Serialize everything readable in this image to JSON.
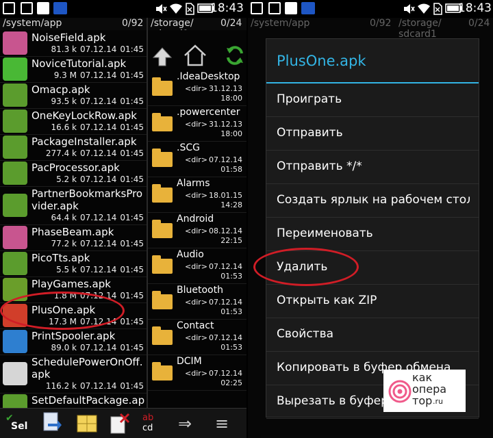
{
  "status_bar": {
    "time": "18:43"
  },
  "left_panel": {
    "path": "/system/app",
    "count": "0/92",
    "items": [
      {
        "name": "NoiseField.apk",
        "size": "81.3 k",
        "date": "07.12.14",
        "time": "01:45",
        "icon": "noisefield-icon",
        "color": "#c8558f"
      },
      {
        "name": "NoviceTutorial.apk",
        "size": "9.3 M",
        "date": "07.12.14",
        "time": "01:45",
        "icon": "novice-tutorial-icon",
        "color": "#49b835"
      },
      {
        "name": "Omacp.apk",
        "size": "93.5 k",
        "date": "07.12.14",
        "time": "01:45",
        "icon": "android-icon",
        "color": "#5b9c2d"
      },
      {
        "name": "OneKeyLockRow.apk",
        "size": "16.6 k",
        "date": "07.12.14",
        "time": "01:45",
        "icon": "android-icon",
        "color": "#5b9c2d"
      },
      {
        "name": "PackageInstaller.apk",
        "size": "277.4 k",
        "date": "07.12.14",
        "time": "01:45",
        "icon": "android-icon",
        "color": "#5b9c2d"
      },
      {
        "name": "PacProcessor.apk",
        "size": "5.2 k",
        "date": "07.12.14",
        "time": "01:45",
        "icon": "android-icon",
        "color": "#5b9c2d"
      },
      {
        "name": "PartnerBookmarksProvider.apk",
        "size": "64.4 k",
        "date": "07.12.14",
        "time": "01:45",
        "icon": "android-icon",
        "color": "#5b9c2d"
      },
      {
        "name": "PhaseBeam.apk",
        "size": "77.2 k",
        "date": "07.12.14",
        "time": "01:45",
        "icon": "phasebeam-icon",
        "color": "#c8558f"
      },
      {
        "name": "PicoTts.apk",
        "size": "5.5 k",
        "date": "07.12.14",
        "time": "01:45",
        "icon": "android-icon",
        "color": "#5b9c2d"
      },
      {
        "name": "PlayGames.apk",
        "size": "1.8 M",
        "date": "07.12.14",
        "time": "01:45",
        "icon": "play-games-icon",
        "color": "#6a9e2a"
      },
      {
        "name": "PlusOne.apk",
        "size": "17.3 M",
        "date": "07.12.14",
        "time": "01:45",
        "icon": "google-plus-icon",
        "color": "#d13e2a"
      },
      {
        "name": "PrintSpooler.apk",
        "size": "89.0 k",
        "date": "07.12.14",
        "time": "01:45",
        "icon": "print-spooler-icon",
        "color": "#2e7fd0"
      },
      {
        "name": "SchedulePowerOnOff.apk",
        "size": "116.2 k",
        "date": "07.12.14",
        "time": "01:45",
        "icon": "settings-gear-icon",
        "color": "#d6d6d6"
      },
      {
        "name": "SetDefaultPackage.apk",
        "size": "",
        "date": "",
        "time": "",
        "icon": "android-icon",
        "color": "#5b9c2d"
      }
    ]
  },
  "right_panel": {
    "path_line1": "/storage/",
    "path_line2": "sdcard1",
    "count": "0/24",
    "folders": [
      {
        "name": ".IdeaDesktop",
        "tag": "<dir>",
        "date": "31.12.13",
        "time": "18:00"
      },
      {
        "name": ".powercenter",
        "tag": "<dir>",
        "date": "31.12.13",
        "time": "18:00"
      },
      {
        "name": ".SCG",
        "tag": "<dir>",
        "date": "07.12.14",
        "time": "01:58"
      },
      {
        "name": "Alarms",
        "tag": "<dir>",
        "date": "18.01.15",
        "time": "14:28"
      },
      {
        "name": "Android",
        "tag": "<dir>",
        "date": "08.12.14",
        "time": "22:15"
      },
      {
        "name": "Audio",
        "tag": "<dir>",
        "date": "07.12.14",
        "time": "01:53"
      },
      {
        "name": "Bluetooth",
        "tag": "<dir>",
        "date": "07.12.14",
        "time": "01:53"
      },
      {
        "name": "Contact",
        "tag": "<dir>",
        "date": "07.12.14",
        "time": "01:53"
      },
      {
        "name": "DCIM",
        "tag": "<dir>",
        "date": "07.12.14",
        "time": "02:25"
      }
    ]
  },
  "toolbar": {
    "sel_label": "Sel",
    "abc_top": "ab",
    "abc_bottom": "cd"
  },
  "dialog": {
    "title": "PlusOne.apk",
    "items": [
      "Проиграть",
      "Отправить",
      "Отправить */*",
      "Создать ярлык на рабочем столе",
      "Переименовать",
      "Удалить",
      "Открыть как ZIP",
      "Свойства",
      "Копировать в буфер обмена",
      "Вырезать в буфер"
    ]
  },
  "watermark": {
    "line1": "как",
    "line2": "опера",
    "line3": "тор",
    "suffix": ".ru"
  },
  "colors": {
    "accent": "#33b5e5",
    "highlight": "#d01d26",
    "folder": "#e8b23a"
  }
}
